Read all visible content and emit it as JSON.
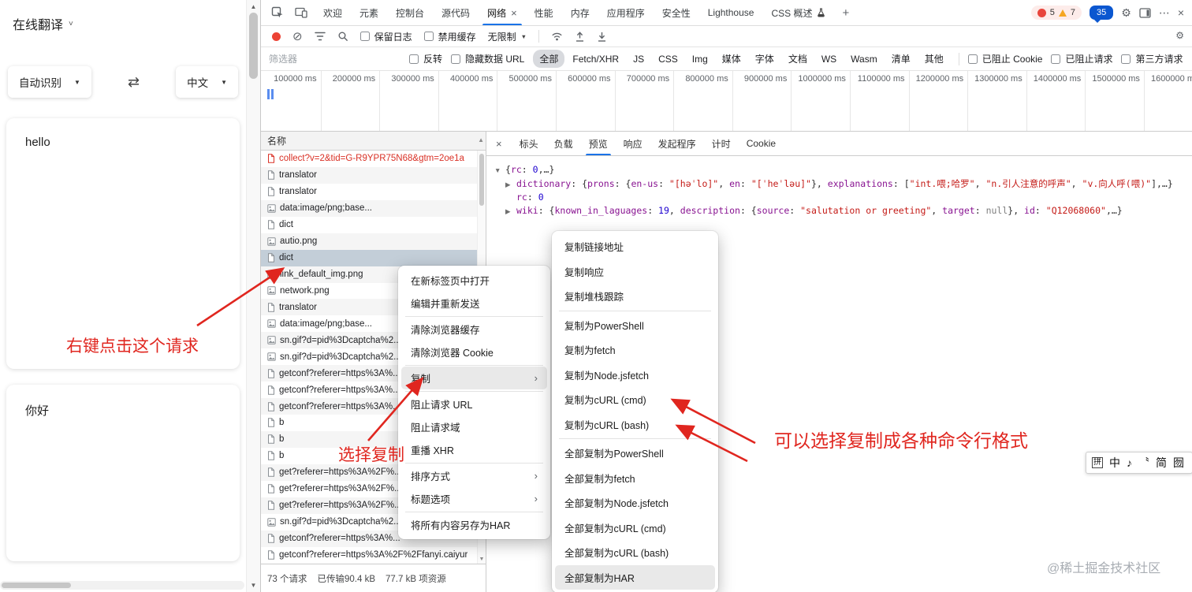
{
  "app": {
    "title": "在线翻译",
    "title_caret": "˅",
    "source_lang": "自动识别",
    "target_lang": "中文",
    "source_text": "hello",
    "target_text": "你好"
  },
  "icons": {
    "swap": "⇄",
    "caret_down": "▼",
    "clear": "⊘",
    "gear": "⚙",
    "more": "⋯",
    "close": "×",
    "plus": "+",
    "chevron_right": "›",
    "scroll_up": "▲",
    "scroll_down": "▼"
  },
  "devtools": {
    "tabs": [
      {
        "id": "welcome",
        "label": "欢迎"
      },
      {
        "id": "elements",
        "label": "元素"
      },
      {
        "id": "console",
        "label": "控制台"
      },
      {
        "id": "sources",
        "label": "源代码"
      },
      {
        "id": "network",
        "label": "网络",
        "closable": true,
        "active": true
      },
      {
        "id": "performance",
        "label": "性能"
      },
      {
        "id": "memory",
        "label": "内存"
      },
      {
        "id": "application",
        "label": "应用程序"
      },
      {
        "id": "security",
        "label": "安全性"
      },
      {
        "id": "lighthouse",
        "label": "Lighthouse"
      },
      {
        "id": "css-overview",
        "label": "CSS 概述",
        "flask": true
      }
    ],
    "badges": {
      "errors": "5",
      "warnings": "7",
      "issues": "35"
    },
    "toolbar": {
      "preserve_log": "保留日志",
      "disable_cache": "禁用缓存",
      "throttling": "无限制"
    },
    "filters": {
      "placeholder": "筛选器",
      "invert": "反转",
      "hide_data_urls": "隐藏数据 URL",
      "pills": [
        "全部",
        "Fetch/XHR",
        "JS",
        "CSS",
        "Img",
        "媒体",
        "字体",
        "文档",
        "WS",
        "Wasm",
        "清单",
        "其他"
      ],
      "active_pill": "全部",
      "blocked_cookies": "已阻止 Cookie",
      "blocked_requests": "已阻止请求",
      "third_party": "第三方请求"
    },
    "timeline_labels": [
      "100000 ms",
      "200000 ms",
      "300000 ms",
      "400000 ms",
      "500000 ms",
      "600000 ms",
      "700000 ms",
      "800000 ms",
      "900000 ms",
      "1000000 ms",
      "1100000 ms",
      "1200000 ms",
      "1300000 ms",
      "1400000 ms",
      "1500000 ms",
      "1600000 ms"
    ],
    "network": {
      "name_header": "名称",
      "rows": [
        {
          "name": "collect?v=2&tid=G-R9YPR75N68&gtm=2oe1a",
          "error": true
        },
        {
          "name": "translator"
        },
        {
          "name": "translator"
        },
        {
          "name": "data:image/png;base...",
          "kind": "img"
        },
        {
          "name": "dict"
        },
        {
          "name": "autio.png",
          "kind": "img"
        },
        {
          "name": "dict",
          "selected": true
        },
        {
          "name": "link_default_img.png",
          "kind": "img"
        },
        {
          "name": "network.png",
          "kind": "img"
        },
        {
          "name": "translator"
        },
        {
          "name": "data:image/png;base...",
          "kind": "img"
        },
        {
          "name": "sn.gif?d=pid%3Dcaptcha%2...",
          "kind": "img"
        },
        {
          "name": "sn.gif?d=pid%3Dcaptcha%2...",
          "kind": "img"
        },
        {
          "name": "getconf?referer=https%3A%..."
        },
        {
          "name": "getconf?referer=https%3A%..."
        },
        {
          "name": "getconf?referer=https%3A%..."
        },
        {
          "name": "b"
        },
        {
          "name": "b"
        },
        {
          "name": "b"
        },
        {
          "name": "get?referer=https%3A%2F%..."
        },
        {
          "name": "get?referer=https%3A%2F%..."
        },
        {
          "name": "get?referer=https%3A%2F%..."
        },
        {
          "name": "sn.gif?d=pid%3Dcaptcha%2...",
          "kind": "img"
        },
        {
          "name": "getconf?referer=https%3A%..."
        },
        {
          "name": "getconf?referer=https%3A%2F%2Ffanyi.caiyur"
        }
      ],
      "summary": {
        "requests": "73 个请求",
        "transferred": "已传输90.4 kB",
        "resources": "77.7 kB 项资源"
      }
    },
    "detail_tabs": [
      {
        "label": "标头"
      },
      {
        "label": "负载"
      },
      {
        "label": "预览",
        "active": true
      },
      {
        "label": "响应"
      },
      {
        "label": "发起程序"
      },
      {
        "label": "计时"
      },
      {
        "label": "Cookie"
      }
    ],
    "preview_lines": [
      {
        "arrow": "▼",
        "child": false,
        "segments": [
          {
            "t": "{",
            "c": "p"
          },
          {
            "t": "rc",
            "c": "k"
          },
          {
            "t": ": ",
            "c": "p"
          },
          {
            "t": "0",
            "c": "n"
          },
          {
            "t": ",…}",
            "c": "p"
          }
        ]
      },
      {
        "arrow": "▶",
        "child": true,
        "segments": [
          {
            "t": "dictionary",
            "c": "k"
          },
          {
            "t": ": {",
            "c": "p"
          },
          {
            "t": "prons",
            "c": "k"
          },
          {
            "t": ": {",
            "c": "p"
          },
          {
            "t": "en-us",
            "c": "k"
          },
          {
            "t": ": ",
            "c": "p"
          },
          {
            "t": "\"[həˈlo]\"",
            "c": "s"
          },
          {
            "t": ", ",
            "c": "p"
          },
          {
            "t": "en",
            "c": "k"
          },
          {
            "t": ": ",
            "c": "p"
          },
          {
            "t": "\"[ˈheˈləu]\"",
            "c": "s"
          },
          {
            "t": "}, ",
            "c": "p"
          },
          {
            "t": "explanations",
            "c": "k"
          },
          {
            "t": ": [",
            "c": "p"
          },
          {
            "t": "\"int.喂;哈罗\"",
            "c": "s"
          },
          {
            "t": ", ",
            "c": "p"
          },
          {
            "t": "\"n.引人注意的呼声\"",
            "c": "s"
          },
          {
            "t": ", ",
            "c": "p"
          },
          {
            "t": "\"v.向人呼(喂)\"",
            "c": "s"
          },
          {
            "t": "],…}",
            "c": "p"
          }
        ]
      },
      {
        "arrow": "",
        "child": true,
        "segments": [
          {
            "t": "rc",
            "c": "k"
          },
          {
            "t": ": ",
            "c": "p"
          },
          {
            "t": "0",
            "c": "n"
          }
        ]
      },
      {
        "arrow": "▶",
        "child": true,
        "segments": [
          {
            "t": "wiki",
            "c": "k"
          },
          {
            "t": ": {",
            "c": "p"
          },
          {
            "t": "known_in_laguages",
            "c": "k"
          },
          {
            "t": ": ",
            "c": "p"
          },
          {
            "t": "19",
            "c": "n"
          },
          {
            "t": ", ",
            "c": "p"
          },
          {
            "t": "description",
            "c": "k"
          },
          {
            "t": ": {",
            "c": "p"
          },
          {
            "t": "source",
            "c": "k"
          },
          {
            "t": ": ",
            "c": "p"
          },
          {
            "t": "\"salutation or greeting\"",
            "c": "s"
          },
          {
            "t": ", ",
            "c": "p"
          },
          {
            "t": "target",
            "c": "k"
          },
          {
            "t": ": ",
            "c": "p"
          },
          {
            "t": "null",
            "c": "u"
          },
          {
            "t": "}, ",
            "c": "p"
          },
          {
            "t": "id",
            "c": "k"
          },
          {
            "t": ": ",
            "c": "p"
          },
          {
            "t": "\"Q12068060\"",
            "c": "s"
          },
          {
            "t": ",…}",
            "c": "p"
          }
        ]
      }
    ]
  },
  "context_menu": {
    "items": [
      {
        "label": "在新标签页中打开"
      },
      {
        "label": "编辑并重新发送"
      },
      {
        "sep": true
      },
      {
        "label": "清除浏览器缓存"
      },
      {
        "label": "清除浏览器 Cookie"
      },
      {
        "sep": true
      },
      {
        "label": "复制",
        "submenu": true,
        "highlight": true
      },
      {
        "sep": true
      },
      {
        "label": "阻止请求 URL"
      },
      {
        "label": "阻止请求域"
      },
      {
        "label": "重播 XHR"
      },
      {
        "sep": true
      },
      {
        "label": "排序方式",
        "submenu": true
      },
      {
        "label": "标题选项",
        "submenu": true
      },
      {
        "sep": true
      },
      {
        "label": "将所有内容另存为HAR"
      }
    ]
  },
  "copy_submenu": {
    "items": [
      {
        "label": "复制链接地址"
      },
      {
        "label": "复制响应"
      },
      {
        "label": "复制堆栈跟踪"
      },
      {
        "sep": true
      },
      {
        "label": "复制为PowerShell"
      },
      {
        "label": "复制为fetch"
      },
      {
        "label": "复制为Node.jsfetch"
      },
      {
        "label": "复制为cURL (cmd)"
      },
      {
        "label": "复制为cURL (bash)"
      },
      {
        "sep": true
      },
      {
        "label": "全部复制为PowerShell"
      },
      {
        "label": "全部复制为fetch"
      },
      {
        "label": "全部复制为Node.jsfetch"
      },
      {
        "label": "全部复制为cURL (cmd)"
      },
      {
        "label": "全部复制为cURL (bash)"
      },
      {
        "label": "全部复制为HAR",
        "highlight": true
      }
    ]
  },
  "annotations": {
    "color": "#e0261f",
    "note_request": "右键点击这个请求",
    "note_copy": "选择复制",
    "note_formats": "可以选择复制成各种命令行格式"
  },
  "ime_bar": [
    {
      "glyph": "拼",
      "name": "pinyin-indicator"
    },
    {
      "glyph": "中",
      "name": "chinese-english-toggle"
    },
    {
      "glyph": "♪",
      "name": "sound-toggle"
    },
    {
      "glyph": "〝",
      "name": "punctuation-toggle"
    },
    {
      "glyph": "简",
      "name": "simplified-traditional-toggle"
    },
    {
      "glyph": "囫",
      "name": "more-tools"
    }
  ],
  "watermark": "@稀土掘金技术社区"
}
